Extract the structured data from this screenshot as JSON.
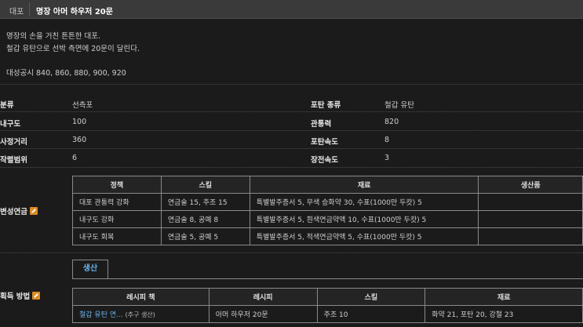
{
  "header": {
    "category": "대포",
    "title": "명장 아머 하우저 20문"
  },
  "description": {
    "line1": "명장의 손을 거친 튼튼한 대포.",
    "line2": "철갑 유탄으로 선박 측면에 20문이 달린다.",
    "line3": "대성공시 840, 860, 880, 900, 920"
  },
  "stats": {
    "class_label": "분류",
    "class_value": "선측포",
    "shell_label": "포탄 종류",
    "shell_value": "철갑 유탄",
    "durability_label": "내구도",
    "durability_value": "100",
    "penetration_label": "관통력",
    "penetration_value": "820",
    "range_label": "사정거리",
    "range_value": "360",
    "speed_label": "포탄속도",
    "speed_value": "8",
    "spread_label": "작렬범위",
    "spread_value": "6",
    "reload_label": "장전속도",
    "reload_value": "3"
  },
  "modify": {
    "label": "변성연금",
    "headers": [
      "정책",
      "스킬",
      "재료",
      "생산품"
    ],
    "rows": [
      {
        "policy": "대포 관통력 강화",
        "skill": "연금술 15, 주조 15",
        "materials": "특별발주증서 5, 무색 승화약 30, 수표(1000만 두캇) 5",
        "product": ""
      },
      {
        "policy": "내구도 강화",
        "skill": "연금술 8, 공예 8",
        "materials": "특별발주증서 5, 흰색연금약액 10, 수표(1000만 두캇) 5",
        "product": ""
      },
      {
        "policy": "내구도 회복",
        "skill": "연금술 5, 공예 5",
        "materials": "특별발주증서 5, 적색연금약액 5, 수표(1000만 두캇) 5",
        "product": ""
      }
    ]
  },
  "acquire": {
    "label": "획득 방법",
    "tab": "생산",
    "headers": [
      "레시피 책",
      "레시피",
      "스킬",
      "재료"
    ],
    "rows": [
      {
        "book": "철갑 유탄 연...",
        "book_note": "(추구 생산)",
        "recipe": "아머 하우저 20문",
        "skill": "주조 10",
        "materials": "화약 21, 포탄 20, 강철 23"
      }
    ]
  },
  "colors": {
    "link": "#6bb3ea",
    "edit_icon": "#e08a1e",
    "header_bg": "#3a3a3a",
    "body_bg": "#1b1b1b"
  }
}
